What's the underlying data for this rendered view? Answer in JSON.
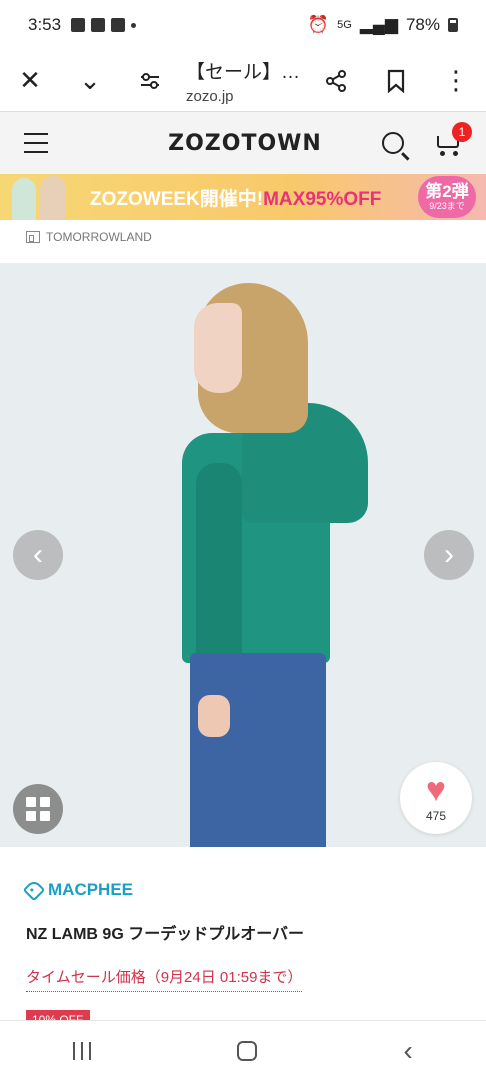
{
  "status": {
    "time": "3:53",
    "network": "5G",
    "battery": "78%"
  },
  "browser": {
    "close_icon": "close-icon",
    "title": "【セール】…",
    "url": "zozo.jp"
  },
  "site": {
    "logo": "ZOZOTOWN",
    "cart_count": "1"
  },
  "banner": {
    "text_main": "ZOZOWEEK開催中!",
    "text_accent": "MAX95%OFF",
    "round_main": "第2弾",
    "round_date": "9/23まで"
  },
  "shop": {
    "name": "TOMORROWLAND"
  },
  "product": {
    "favorite_count": "475",
    "brand": "MACPHEE",
    "name": "NZ LAMB 9G フーデッドプルオーバー",
    "sale_label": "タイムセール価格（9月24日 01:59まで）",
    "off_badge": "10% OFF"
  },
  "colors": {
    "accent_pink": "#e6337a",
    "brand_blue": "#1aa0c8",
    "sale_red": "#d0334a",
    "sweater_green": "#1f9480"
  }
}
